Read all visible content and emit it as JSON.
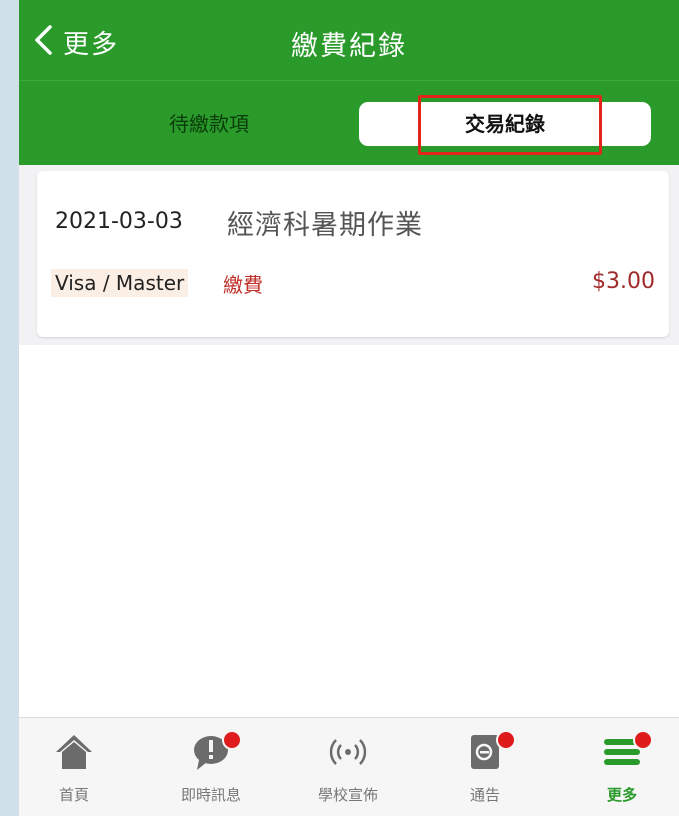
{
  "header": {
    "back_label": "更多",
    "title": "繳費紀錄",
    "background_color": "#2a9a2a"
  },
  "tabs": [
    {
      "label": "待繳款項",
      "selected": false
    },
    {
      "label": "交易紀錄",
      "selected": true
    }
  ],
  "records": [
    {
      "date": "2021-03-03",
      "title": "經濟科暑期作業",
      "payment_method": "Visa / Master",
      "type": "繳費",
      "amount": "$3.00"
    }
  ],
  "tabbar": {
    "items": [
      {
        "label": "首頁",
        "icon": "home-icon",
        "badge": false,
        "active": false
      },
      {
        "label": "即時訊息",
        "icon": "message-icon",
        "badge": true,
        "active": false
      },
      {
        "label": "學校宣佈",
        "icon": "broadcast-icon",
        "badge": false,
        "active": false
      },
      {
        "label": "通告",
        "icon": "notice-icon",
        "badge": true,
        "active": false
      },
      {
        "label": "更多",
        "icon": "menu-icon",
        "badge": true,
        "active": true
      }
    ],
    "active_color": "#2a9a2a",
    "badge_color": "#e01b1b"
  }
}
